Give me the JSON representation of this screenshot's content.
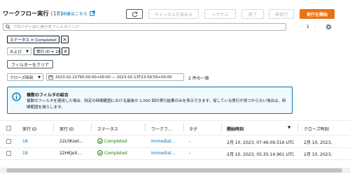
{
  "header": {
    "title": "ワークフロー実行",
    "count": "(18)",
    "info_link": "詳細はこちら"
  },
  "toolbar": {
    "refresh_icon": "refresh-icon",
    "cancel_label": "キャンセルを試みる",
    "signal_label": "シグナル",
    "terminate_label": "終了",
    "restart_label": "再実行",
    "start_label": "実行を開始"
  },
  "search": {
    "placeholder": "プロパティ別に実行をフィルタリング"
  },
  "pager": {
    "prev": "‹",
    "page": "1",
    "next": "›"
  },
  "filters": {
    "token1": "ステータス = Completed",
    "operator": "および",
    "token2": "実行 ID = 18",
    "clear_label": "フィルターをクリア"
  },
  "time_filter": {
    "select_label": "クローズ時刻",
    "range": "2023-01-21T00:00:00+00:00 — 2023-02-13T23:59:59+00:00",
    "match_count": "2 件の一致"
  },
  "alert": {
    "title": "複数のフィルタの結合",
    "body": "複数のフィルタを適用した場合、特定の時間範囲における最後の 1,000 回の実行結果のみを表示できます。探している実行が見つからない場合は、時間範囲を減らします。"
  },
  "table": {
    "columns": [
      "実行 ID",
      "実行 ID",
      "ステータス",
      "ワークフ...",
      "タグ",
      "開始時刻",
      "クローズ時刻"
    ],
    "rows": [
      {
        "run_id": "18",
        "exec_id": "22L0Kset...",
        "status": "Completed",
        "workflow": "Immediat...",
        "tag": "-",
        "start": "2月 10, 2023, 07:46:09.516 UTC",
        "close": "2月 10, 2023,"
      },
      {
        "run_id": "18",
        "exec_id": "22HKJeX...",
        "status": "Completed",
        "workflow": "Immediat...",
        "tag": "-",
        "start": "2月 10, 2023, 05:35:14.961 UTC",
        "close": "2月 10, 2023,"
      }
    ]
  },
  "colors": {
    "accent": "#0073bb",
    "primary": "#ec7211",
    "success": "#1d8102"
  }
}
